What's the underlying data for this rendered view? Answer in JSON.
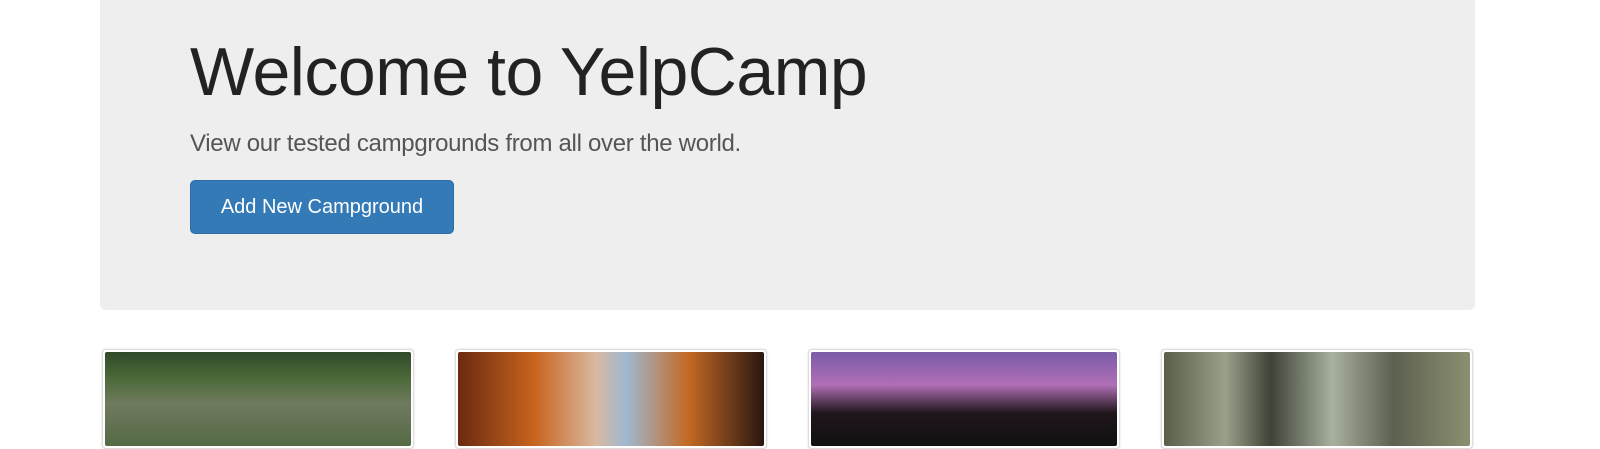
{
  "jumbotron": {
    "title": "Welcome to YelpCamp",
    "subtitle": "View our tested campgrounds from all over the world.",
    "add_button_label": "Add New Campground",
    "button_color": "#337ab7",
    "background_color": "#eeeeee"
  },
  "campgrounds": [
    {
      "image": "forest-lake-rocks"
    },
    {
      "image": "tent-sunset-view"
    },
    {
      "image": "purple-sunset-trees"
    },
    {
      "image": "forest-hammock-tent"
    }
  ]
}
